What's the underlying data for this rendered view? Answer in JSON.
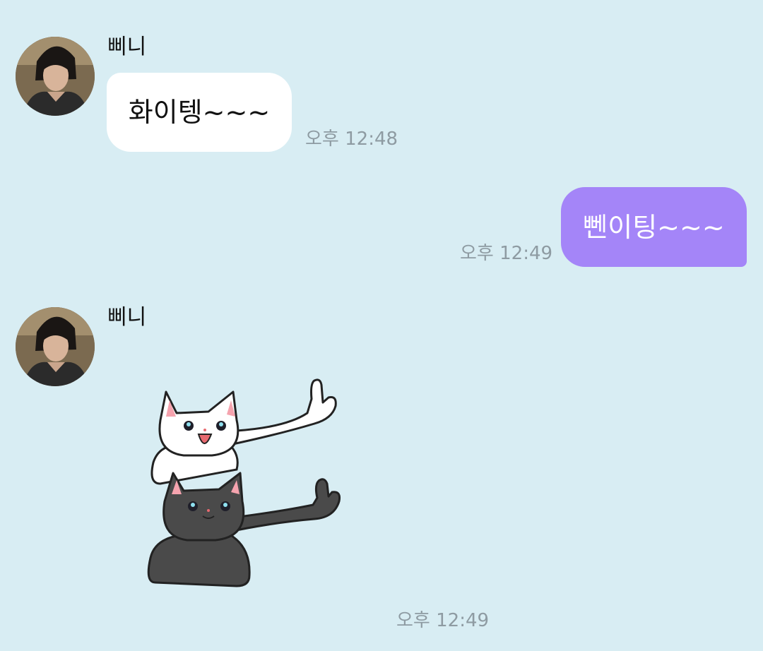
{
  "messages": [
    {
      "direction": "incoming",
      "sender": "삐니",
      "text": "화이텡~~~",
      "time": "오후 12:48"
    },
    {
      "direction": "outgoing",
      "text": "뻰이팅~~~",
      "time": "오후 12:49"
    },
    {
      "direction": "incoming",
      "sender": "삐니",
      "content_type": "sticker",
      "sticker": "white-and-black-cats-thumbs-up",
      "time": "오후 12:49"
    }
  ],
  "colors": {
    "background": "#d8edf3",
    "incoming_bubble": "#ffffff",
    "outgoing_bubble": "#a485f8",
    "timestamp": "#8e9ba2"
  }
}
